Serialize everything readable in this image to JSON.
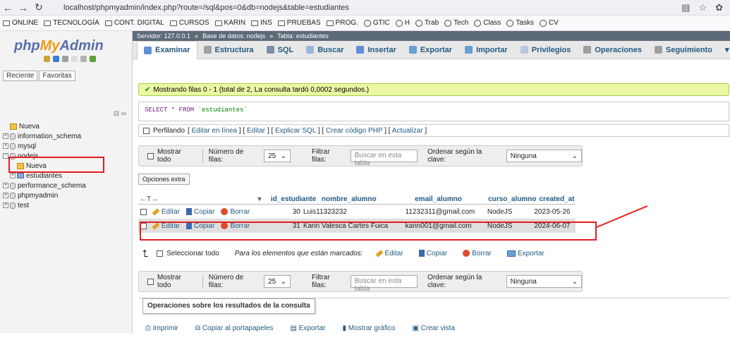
{
  "browser": {
    "url": "localhost/phpmyadmin/index.php?route=/sql&pos=0&db=nodejs&table=estudiantes",
    "bookmarks": [
      "ONLINE",
      "TECNOLOGÍA",
      "CONT. DIGITAL",
      "CURSOS",
      "KARIN",
      "INS",
      "PRUEBAS",
      "PROG.",
      "GTIC",
      "H",
      "Trab",
      "Tech",
      "Class",
      "Tasks",
      "CV"
    ]
  },
  "sidebar": {
    "logo_php": "php",
    "logo_my": "My",
    "logo_admin": "Admin",
    "tabs": [
      "Reciente",
      "Favoritas"
    ],
    "tree": [
      {
        "label": "Nueva",
        "kind": "new",
        "indent": 1
      },
      {
        "label": "information_schema",
        "kind": "db",
        "indent": 0
      },
      {
        "label": "mysql",
        "kind": "db",
        "indent": 0
      },
      {
        "label": "nodejs",
        "kind": "db",
        "indent": 0
      },
      {
        "label": "Nueva",
        "kind": "new",
        "indent": 2
      },
      {
        "label": "estudiantes",
        "kind": "tbl",
        "indent": 1
      },
      {
        "label": "performance_schema",
        "kind": "db",
        "indent": 0
      },
      {
        "label": "phpmyadmin",
        "kind": "db",
        "indent": 0
      },
      {
        "label": "test",
        "kind": "db",
        "indent": 0
      }
    ]
  },
  "breadcrumb": {
    "server": "Servidor: 127.0.0.1",
    "database": "Base de datos: nodejs",
    "table": "Tabla: estudiantes"
  },
  "tabs": [
    "Examinar",
    "Estructura",
    "SQL",
    "Buscar",
    "Insertar",
    "Exportar",
    "Importar",
    "Privilegios",
    "Operaciones",
    "Seguimiento"
  ],
  "message": "Mostrando filas 0 - 1 (total de 2, La consulta tardó 0,0002 segundos.)",
  "sql": {
    "keyword": "SELECT * FROM",
    "table": "`estudiantes`"
  },
  "profiling": {
    "label": "Perfilando",
    "links": [
      "Editar en línea",
      "Editar",
      "Explicar SQL",
      "Crear código PHP",
      "Actualizar"
    ]
  },
  "nav": {
    "show_all": "Mostrar todo",
    "rows_label": "Número de filas:",
    "rows_value": "25",
    "filter_label": "Filtrar filas:",
    "filter_placeholder": "Buscar en esta tabla",
    "sort_label": "Ordenar según la clave:",
    "sort_value": "Ninguna"
  },
  "extra_options": "Opciones extra",
  "table": {
    "columns": [
      "id_estudiante",
      "nombre_alumno",
      "email_alumno",
      "curso_alumno",
      "created_at"
    ],
    "actions": [
      "Editar",
      "Copiar",
      "Borrar"
    ],
    "rows": [
      {
        "id": "30",
        "nombre": "Luis11323232",
        "email": "11232311@gmail.com",
        "curso": "NodeJS",
        "created": "2023-05-26"
      },
      {
        "id": "31",
        "nombre": "Karin Valesca Cartes Fuica",
        "email": "karin001@gmail.com",
        "curso": "NodeJS",
        "created": "2024-06-07"
      }
    ]
  },
  "bulk": {
    "select_all": "Seleccionar todo",
    "marked": "Para los elementos que están marcados:",
    "edit": "Editar",
    "copy": "Copiar",
    "delete": "Borrar",
    "export": "Exportar"
  },
  "ops": {
    "title": "Operaciones sobre los resultados de la consulta",
    "links": [
      "Imprimir",
      "Copiar al portapapeles",
      "Exportar",
      "Mostrar gráfico",
      "Crear vista"
    ]
  },
  "colors": {
    "highlight": "#e41e1e",
    "link": "#235a81",
    "success_bg": "#ebf8a4"
  }
}
